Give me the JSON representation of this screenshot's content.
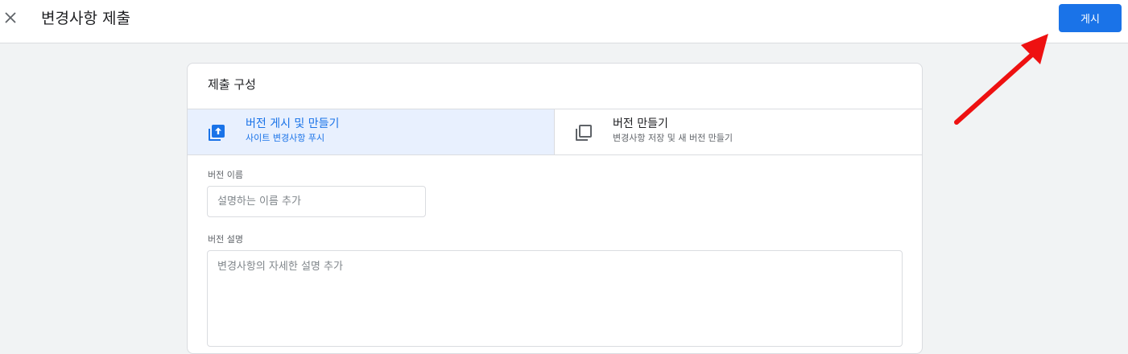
{
  "header": {
    "title": "변경사항 제출",
    "publish_label": "게시"
  },
  "submission": {
    "section_title": "제출 구성",
    "options": [
      {
        "title": "버전 게시 및 만들기",
        "subtitle": "사이트 변경사항 푸시",
        "icon": "publish-icon",
        "selected": true
      },
      {
        "title": "버전 만들기",
        "subtitle": "변경사항 저장 및 새 버전 만들기",
        "icon": "copy-version-icon",
        "selected": false
      }
    ],
    "version_name": {
      "label": "버전 이름",
      "placeholder": "설명하는 이름 추가",
      "value": ""
    },
    "version_description": {
      "label": "버전 설명",
      "placeholder": "변경사항의 자세한 설명 추가",
      "value": ""
    }
  },
  "colors": {
    "accent": "#1a73e8",
    "selected_bg": "#e8f0fe",
    "page_bg": "#f1f3f4",
    "annotation_arrow": "#ee1111"
  }
}
